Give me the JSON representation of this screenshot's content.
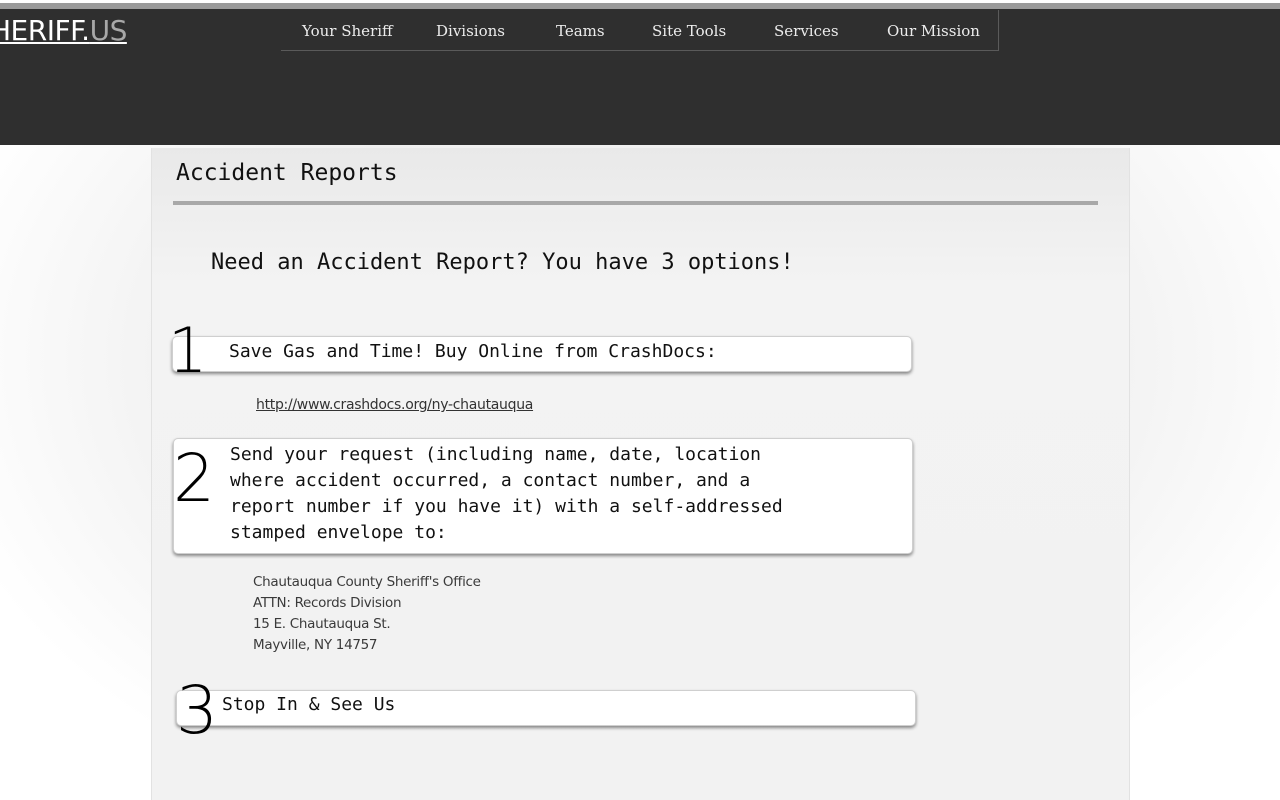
{
  "header": {
    "logo_main": "HERIFF.",
    "logo_suffix": "US",
    "nav": [
      {
        "label": "Your Sheriff"
      },
      {
        "label": "Divisions"
      },
      {
        "label": "Teams"
      },
      {
        "label": "Site Tools"
      },
      {
        "label": "Services"
      },
      {
        "label": "Our Mission"
      }
    ]
  },
  "main": {
    "title": "Accident Reports",
    "intro": "Need an Accident Report?  You have 3 options!",
    "options": [
      {
        "number": "1",
        "text": "Save Gas and Time!  Buy Online from CrashDocs:",
        "link": "http://www.crashdocs.org/ny-chautauqua"
      },
      {
        "number": "2",
        "text_lines": [
          "Send your request (including name, date, location",
          "where accident occurred, a contact number, and a",
          "report number if you have it) with a self-addressed",
          "stamped envelope to:"
        ],
        "address": [
          "Chautauqua County Sheriff's Office",
          "ATTN: Records Division",
          "15 E. Chautauqua St.",
          "Mayville, NY 14757"
        ]
      },
      {
        "number": "3",
        "text": "Stop In & See Us"
      }
    ]
  },
  "colors": {
    "header_bg": "#2f2f2f",
    "header_rule": "#9a9a9a",
    "nav_text": "#ececec",
    "title_rule": "#a8a8a8",
    "logo_suffix": "#a8a8a8"
  }
}
